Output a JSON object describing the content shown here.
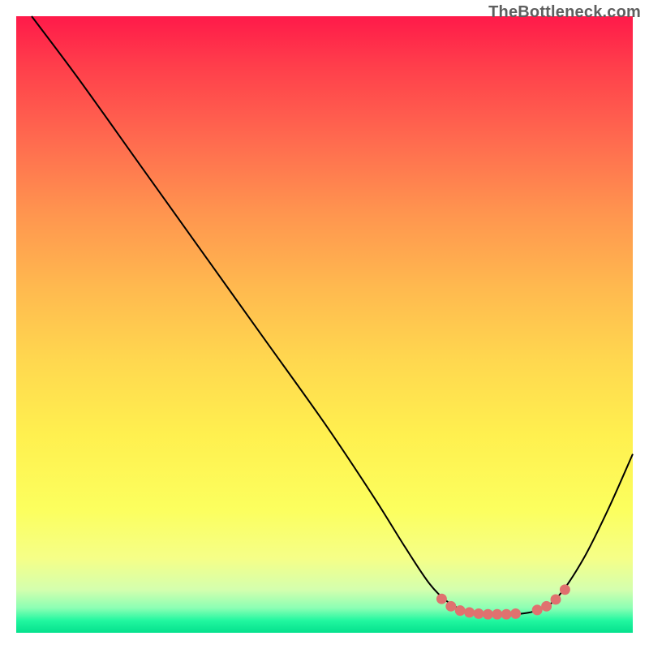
{
  "watermark": "TheBottleneck.com",
  "chart_data": {
    "type": "line",
    "title": "",
    "xlabel": "",
    "ylabel": "",
    "xlim": [
      0,
      100
    ],
    "ylim": [
      0,
      100
    ],
    "curve": [
      {
        "x": 2.5,
        "y": 100
      },
      {
        "x": 10,
        "y": 90
      },
      {
        "x": 20,
        "y": 76
      },
      {
        "x": 30,
        "y": 62
      },
      {
        "x": 40,
        "y": 48
      },
      {
        "x": 50,
        "y": 34
      },
      {
        "x": 58,
        "y": 22
      },
      {
        "x": 63,
        "y": 14
      },
      {
        "x": 67,
        "y": 8
      },
      {
        "x": 70,
        "y": 5
      },
      {
        "x": 73,
        "y": 3.5
      },
      {
        "x": 77,
        "y": 3
      },
      {
        "x": 81,
        "y": 3
      },
      {
        "x": 85,
        "y": 3.8
      },
      {
        "x": 88,
        "y": 6
      },
      {
        "x": 92,
        "y": 12
      },
      {
        "x": 96,
        "y": 20
      },
      {
        "x": 100,
        "y": 29
      }
    ],
    "marker_points": [
      {
        "x": 69,
        "y": 5.5
      },
      {
        "x": 70.5,
        "y": 4.3
      },
      {
        "x": 72,
        "y": 3.6
      },
      {
        "x": 73.5,
        "y": 3.3
      },
      {
        "x": 75,
        "y": 3.1
      },
      {
        "x": 76.5,
        "y": 3.0
      },
      {
        "x": 78,
        "y": 3.0
      },
      {
        "x": 79.5,
        "y": 3.0
      },
      {
        "x": 81,
        "y": 3.1
      },
      {
        "x": 84.5,
        "y": 3.7
      },
      {
        "x": 86,
        "y": 4.3
      },
      {
        "x": 87.5,
        "y": 5.4
      },
      {
        "x": 89,
        "y": 7.0
      }
    ],
    "colors": {
      "curve": "#000000",
      "marker": "#e0716f",
      "gradient_top": "#ff1a4a",
      "gradient_mid": "#fff04f",
      "gradient_bottom": "#04e18d"
    }
  }
}
